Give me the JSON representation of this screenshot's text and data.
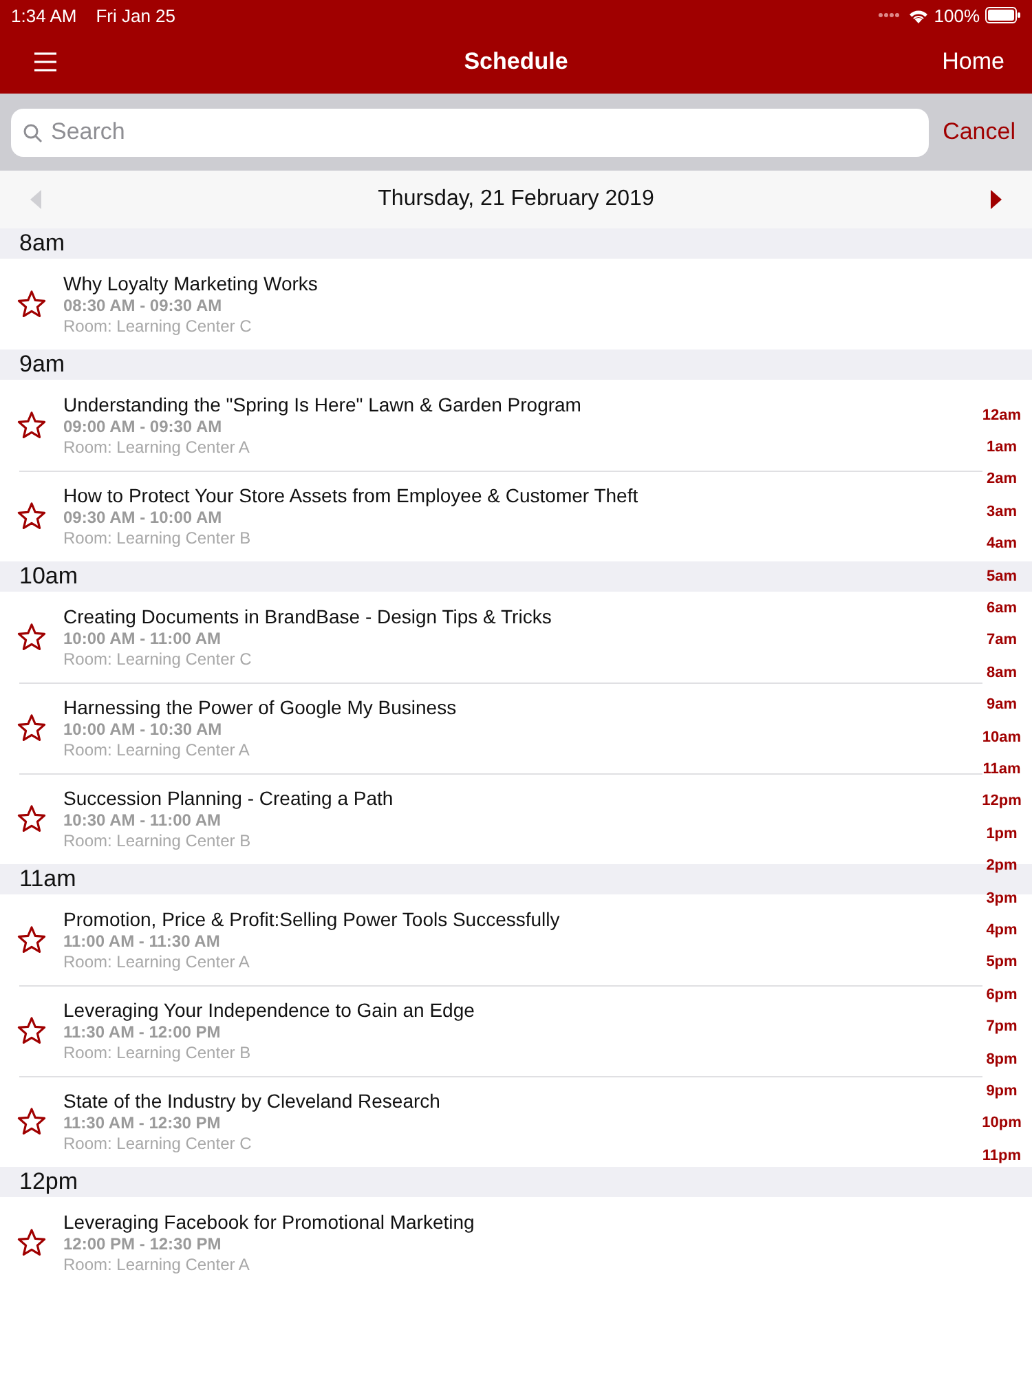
{
  "status_bar": {
    "time": "1:34 AM",
    "date": "Fri Jan 25",
    "battery": "100%"
  },
  "nav_bar": {
    "title": "Schedule",
    "right_button": "Home"
  },
  "search": {
    "placeholder": "Search",
    "cancel": "Cancel"
  },
  "date_bar": {
    "date": "Thursday, 21 February 2019",
    "prev_enabled": false,
    "next_enabled": true
  },
  "sections": [
    {
      "hour": "8am",
      "sessions": [
        {
          "title": "Why Loyalty Marketing Works",
          "time": "08:30 AM - 09:30 AM",
          "room": "Room: Learning Center C",
          "favorite": false
        }
      ]
    },
    {
      "hour": "9am",
      "sessions": [
        {
          "title": "Understanding the \"Spring Is Here\" Lawn & Garden Program",
          "time": "09:00 AM - 09:30 AM",
          "room": "Room: Learning Center A",
          "favorite": false
        },
        {
          "title": "How to Protect Your Store Assets from Employee & Customer Theft",
          "time": "09:30 AM - 10:00 AM",
          "room": "Room: Learning Center B",
          "favorite": false
        }
      ]
    },
    {
      "hour": "10am",
      "sessions": [
        {
          "title": "Creating Documents in BrandBase - Design Tips & Tricks",
          "time": "10:00 AM - 11:00 AM",
          "room": "Room: Learning Center C",
          "favorite": false
        },
        {
          "title": "Harnessing the Power of Google My Business",
          "time": "10:00 AM - 10:30 AM",
          "room": "Room: Learning Center A",
          "favorite": false
        },
        {
          "title": "Succession Planning - Creating a Path",
          "time": "10:30 AM - 11:00 AM",
          "room": "Room: Learning Center B",
          "favorite": false
        }
      ]
    },
    {
      "hour": "11am",
      "sessions": [
        {
          "title": "Promotion, Price & Profit:Selling Power Tools Successfully",
          "time": "11:00 AM - 11:30 AM",
          "room": "Room: Learning Center A",
          "favorite": false
        },
        {
          "title": "Leveraging Your Independence to Gain an Edge",
          "time": "11:30 AM - 12:00 PM",
          "room": "Room: Learning Center B",
          "favorite": false
        },
        {
          "title": "State of the Industry by Cleveland Research",
          "time": "11:30 AM - 12:30 PM",
          "room": "Room: Learning Center C",
          "favorite": false
        }
      ]
    },
    {
      "hour": "12pm",
      "sessions": [
        {
          "title": "Leveraging Facebook for Promotional Marketing",
          "time": "12:00 PM - 12:30 PM",
          "room": "Room: Learning Center A",
          "favorite": false
        }
      ]
    }
  ],
  "hour_index": [
    "12am",
    "1am",
    "2am",
    "3am",
    "4am",
    "5am",
    "6am",
    "7am",
    "8am",
    "9am",
    "10am",
    "11am",
    "12pm",
    "1pm",
    "2pm",
    "3pm",
    "4pm",
    "5pm",
    "6pm",
    "7pm",
    "8pm",
    "9pm",
    "10pm",
    "11pm"
  ]
}
